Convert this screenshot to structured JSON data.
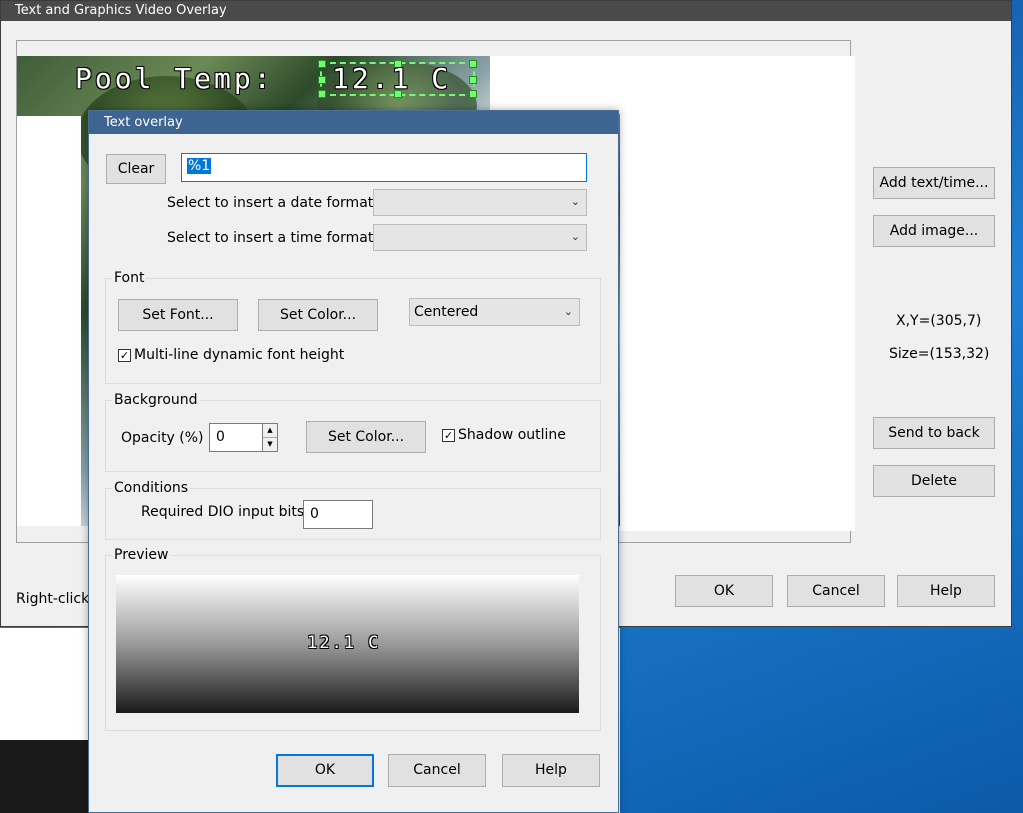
{
  "main_window": {
    "title": "Text and Graphics Video Overlay",
    "overlay_label": "Pool Temp:",
    "overlay_value": "12.1 C",
    "buttons": {
      "add_text": "Add text/time...",
      "add_image": "Add image...",
      "send_to_back": "Send to back",
      "delete": "Delete",
      "ok": "OK",
      "cancel": "Cancel",
      "help": "Help"
    },
    "position_readout": "X,Y=(305,7)",
    "size_readout": "Size=(153,32)",
    "hint_text": "Right-click"
  },
  "dialog": {
    "title": "Text overlay",
    "clear_button": "Clear",
    "text_value": "%1",
    "date_format_label": "Select to insert a date format:",
    "date_format_value": "",
    "time_format_label": "Select to insert a time format:",
    "time_format_value": "",
    "font_group": {
      "label": "Font",
      "set_font_button": "Set Font...",
      "set_color_button": "Set Color...",
      "alignment_value": "Centered",
      "multiline_label": "Multi-line dynamic font height",
      "multiline_checked": true
    },
    "background_group": {
      "label": "Background",
      "opacity_label": "Opacity (%)",
      "opacity_value": "0",
      "set_color_button": "Set Color...",
      "shadow_label": "Shadow outline",
      "shadow_checked": true
    },
    "conditions_group": {
      "label": "Conditions",
      "dio_label": "Required DIO input bits",
      "dio_value": "0"
    },
    "preview_group": {
      "label": "Preview",
      "preview_text": "12.1 C"
    },
    "ok_button": "OK",
    "cancel_button": "Cancel",
    "help_button": "Help"
  },
  "icons": {
    "dropdown": "chevron-down-icon",
    "check": "checkmark-icon",
    "spin_up": "arrow-up-icon",
    "spin_down": "arrow-down-icon"
  },
  "colors": {
    "dialog_title_bar": "#3e6591",
    "main_title_bar": "#4a4a4a",
    "selection_handles": "#6dff6d",
    "default_button_border": "#0078d7",
    "text_selection": "#0078d7"
  }
}
